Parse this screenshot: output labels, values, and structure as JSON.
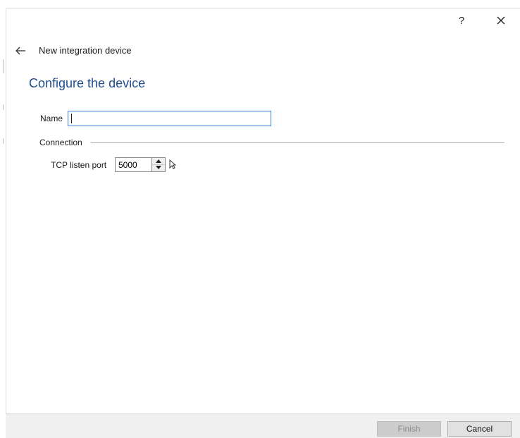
{
  "titlebar": {
    "help_label": "?",
    "close_icon": "close-icon"
  },
  "header": {
    "back_icon": "arrow-left-icon",
    "title": "New integration device"
  },
  "page": {
    "heading": "Configure the device"
  },
  "form": {
    "name_label": "Name",
    "name_value": "",
    "connection_label": "Connection",
    "tcp_port_label": "TCP listen port",
    "tcp_port_value": "5000"
  },
  "footer": {
    "finish_label": "Finish",
    "cancel_label": "Cancel"
  },
  "colors": {
    "heading": "#1f4e8c",
    "input_focus_border": "#3b7bd2",
    "footer_bg": "#f0f0f0"
  }
}
